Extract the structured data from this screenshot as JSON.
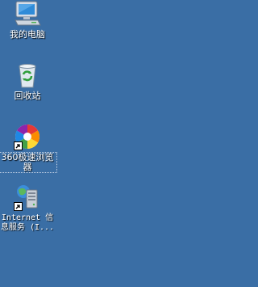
{
  "desktop": {
    "background_color": "#3a6ea5",
    "icons": [
      {
        "label": "我的电脑",
        "icon": "my-computer-icon"
      },
      {
        "label": "回收站",
        "icon": "recycle-bin-icon"
      },
      {
        "label": "360极速浏览器",
        "icon": "360-browser-icon",
        "shortcut": true
      },
      {
        "label": "Internet 信息服务 (I...",
        "icon": "iis-manager-icon",
        "shortcut": true
      }
    ]
  }
}
